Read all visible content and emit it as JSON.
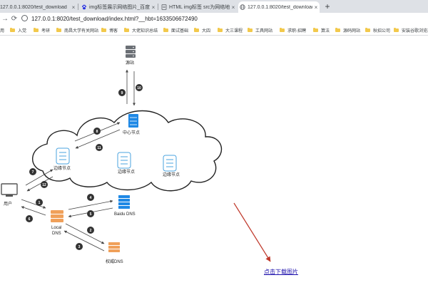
{
  "tabs": [
    {
      "title": "127.0.0.1:8020/test_download",
      "favicon": "globe-icon"
    },
    {
      "title": "img标签展示网络图片_百度搜索",
      "favicon": "baidu-paw-icon"
    },
    {
      "title": "HTML img标签 src为网络地址",
      "favicon": "doc-icon"
    },
    {
      "title": "127.0.0.1:8020/test_download",
      "favicon": "globe-icon"
    }
  ],
  "toolbar": {
    "url_host": "127.0.0.1:8020",
    "url_path": "/test_download/index.html?__hbt=1633506672490"
  },
  "bookmarks": [
    "用",
    "入党",
    "考研",
    "南昌大学有关网站",
    "博客",
    "大佬知识总结",
    "面试基础",
    "大四",
    "大三课程",
    "工具网站",
    "求职-招聘",
    "算法",
    "源码网站",
    "秋招公司",
    "安装谷歌浏览器"
  ],
  "diagram": {
    "source_label": "源站",
    "center_label": "中心节点",
    "edge_label": "边缘节点",
    "user_label": "用户",
    "local_dns_line1": "Local",
    "local_dns_line2": "DNS",
    "baidu_dns_label": "Baidu DNS",
    "auth_dns_label": "权威DNS",
    "steps": [
      "1",
      "2",
      "3",
      "4",
      "5",
      "6",
      "7",
      "8",
      "9",
      "10",
      "11",
      "12"
    ]
  },
  "link": {
    "download_text": "点击下载图片"
  },
  "colors": {
    "arrow_red": "#c0392b",
    "link_blue": "#1a0dab",
    "server_blue": "#1e88e5",
    "dns_orange": "#f0a05a",
    "step_badge": "#333333"
  }
}
